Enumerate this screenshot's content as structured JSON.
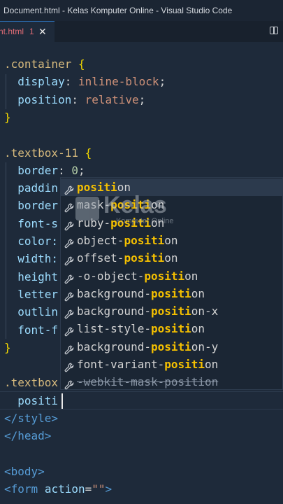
{
  "window": {
    "title": "Document.html - Kelas Komputer Online - Visual Studio Code"
  },
  "tab": {
    "name": "nt.html",
    "problems": "1",
    "close": "✕"
  },
  "code": [
    {
      "tokens": [
        {
          "t": ".container",
          "c": "sel"
        },
        {
          "t": " ",
          "c": "plain"
        },
        {
          "t": "{",
          "c": "brace"
        }
      ]
    },
    {
      "tokens": [
        {
          "t": "  display",
          "c": "prop"
        },
        {
          "t": ": ",
          "c": "plain"
        },
        {
          "t": "inline-block",
          "c": "val"
        },
        {
          "t": ";",
          "c": "plain"
        }
      ]
    },
    {
      "tokens": [
        {
          "t": "  position",
          "c": "prop"
        },
        {
          "t": ": ",
          "c": "plain"
        },
        {
          "t": "relative",
          "c": "val"
        },
        {
          "t": ";",
          "c": "plain"
        }
      ]
    },
    {
      "tokens": [
        {
          "t": "}",
          "c": "brace"
        }
      ]
    },
    {
      "tokens": [
        {
          "t": "",
          "c": "plain"
        }
      ]
    },
    {
      "tokens": [
        {
          "t": ".textbox-11",
          "c": "sel"
        },
        {
          "t": " ",
          "c": "plain"
        },
        {
          "t": "{",
          "c": "brace"
        }
      ]
    },
    {
      "tokens": [
        {
          "t": "  border",
          "c": "prop"
        },
        {
          "t": ": ",
          "c": "plain"
        },
        {
          "t": "0",
          "c": "num"
        },
        {
          "t": ";",
          "c": "plain"
        }
      ]
    },
    {
      "tokens": [
        {
          "t": "  paddin",
          "c": "prop"
        }
      ]
    },
    {
      "tokens": [
        {
          "t": "  border",
          "c": "prop"
        }
      ]
    },
    {
      "tokens": [
        {
          "t": "  font-s",
          "c": "prop"
        }
      ]
    },
    {
      "tokens": [
        {
          "t": "  color:",
          "c": "prop"
        }
      ]
    },
    {
      "tokens": [
        {
          "t": "  width:",
          "c": "prop"
        }
      ]
    },
    {
      "tokens": [
        {
          "t": "  height",
          "c": "prop"
        }
      ]
    },
    {
      "tokens": [
        {
          "t": "  letter",
          "c": "prop"
        }
      ]
    },
    {
      "tokens": [
        {
          "t": "  outlin",
          "c": "prop"
        }
      ]
    },
    {
      "tokens": [
        {
          "t": "  font-f",
          "c": "prop"
        }
      ]
    },
    {
      "tokens": [
        {
          "t": "}",
          "c": "brace"
        }
      ]
    },
    {
      "tokens": [
        {
          "t": "",
          "c": "plain"
        }
      ]
    },
    {
      "tokens": [
        {
          "t": ".textbox",
          "c": "sel"
        }
      ]
    },
    {
      "tokens": [
        {
          "t": "  positi",
          "c": "prop"
        }
      ]
    },
    {
      "tokens": [
        {
          "t": "</style>",
          "c": "tag"
        }
      ]
    },
    {
      "tokens": [
        {
          "t": "</head>",
          "c": "tag"
        }
      ]
    },
    {
      "tokens": [
        {
          "t": "",
          "c": "plain"
        }
      ]
    },
    {
      "tokens": [
        {
          "t": "<body>",
          "c": "tag"
        }
      ]
    },
    {
      "tokens": [
        {
          "t": "<form",
          "c": "tag"
        },
        {
          "t": " ",
          "c": "plain"
        },
        {
          "t": "action",
          "c": "attr"
        },
        {
          "t": "=",
          "c": "plain"
        },
        {
          "t": "\"\"",
          "c": "str"
        },
        {
          "t": ">",
          "c": "tag"
        }
      ]
    }
  ],
  "suggestions": [
    {
      "pre": "",
      "match": "positi",
      "post": "on",
      "active": true
    },
    {
      "pre": "mask-",
      "match": "positi",
      "post": "on"
    },
    {
      "pre": "ruby-",
      "match": "positi",
      "post": "on"
    },
    {
      "pre": "object-",
      "match": "positi",
      "post": "on"
    },
    {
      "pre": "offset-",
      "match": "positi",
      "post": "on"
    },
    {
      "pre": "-o-object-",
      "match": "positi",
      "post": "on"
    },
    {
      "pre": "background-",
      "match": "positi",
      "post": "on"
    },
    {
      "pre": "background-",
      "match": "positi",
      "post": "on-x"
    },
    {
      "pre": "list-style-",
      "match": "positi",
      "post": "on"
    },
    {
      "pre": "background-",
      "match": "positi",
      "post": "on-y"
    },
    {
      "pre": "font-variant-",
      "match": "positi",
      "post": "on"
    },
    {
      "pre": "-webkit-mask-position",
      "match": "",
      "post": "",
      "deprecated": true
    }
  ],
  "watermark": {
    "brand": "Kelas",
    "sub": "Komputer Online",
    "box": "Tutor"
  },
  "colors": {
    "editor_bg": "#1e2a3a",
    "match": "#f5c000",
    "selector": "#d7ba7d",
    "property": "#9cdcfe",
    "value": "#ce9178"
  },
  "icons": {
    "suggestion": "wrench-icon",
    "split": "split-editor-icon"
  }
}
